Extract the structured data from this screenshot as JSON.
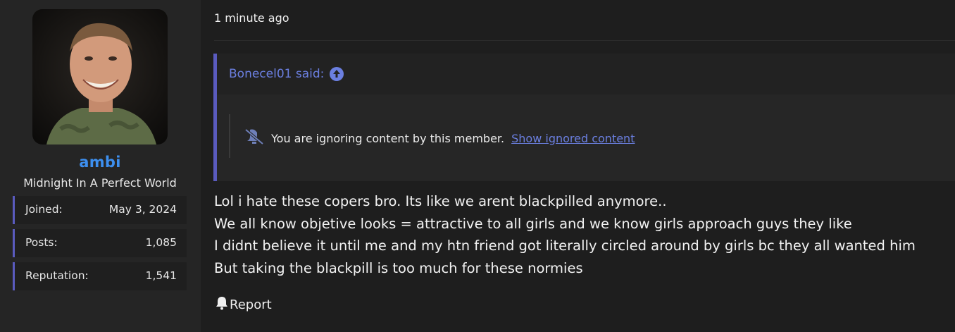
{
  "user": {
    "username": "ambi",
    "title": "Midnight In A Perfect World",
    "stats": [
      {
        "label": "Joined:",
        "value": "May 3, 2024"
      },
      {
        "label": "Posts:",
        "value": "1,085"
      },
      {
        "label": "Reputation:",
        "value": "1,541"
      }
    ]
  },
  "post": {
    "time": "1 minute ago",
    "quote": {
      "author": "Bonecel01 said:",
      "ignored_text": "You are ignoring content by this member.",
      "show_link": "Show ignored content"
    },
    "lines": [
      "Lol i hate these copers bro. Its like we arent blackpilled anymore..",
      "We all know objetive looks = attractive to all girls and we know girls approach guys they like",
      "I didnt believe it until me and my htn friend got literally circled around by girls bc they all wanted him",
      "But taking the blackpill is too much for these normies"
    ],
    "report_label": "Report"
  },
  "colors": {
    "accent": "#5a5bbf",
    "link": "#6b7fe0",
    "username": "#3d8fef"
  }
}
